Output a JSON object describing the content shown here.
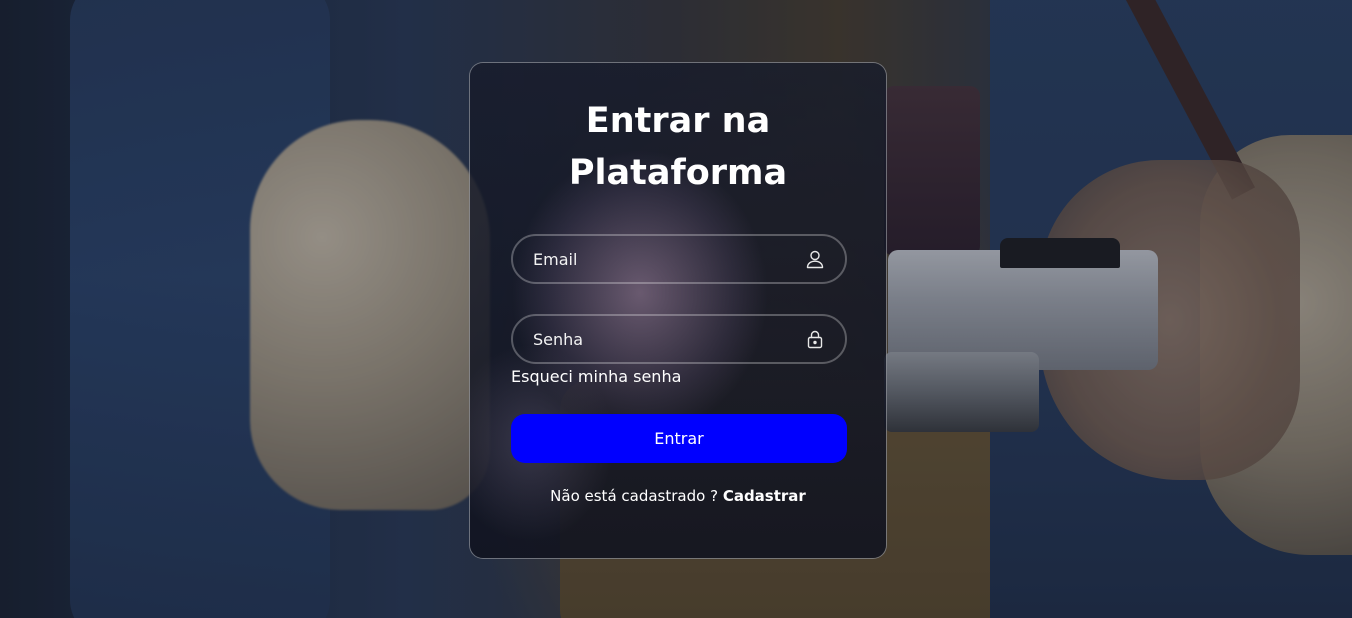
{
  "login": {
    "title_line1": "Entrar na",
    "title_line2": "Plataforma",
    "email": {
      "placeholder": "Email",
      "value": "",
      "icon": "user-icon"
    },
    "password": {
      "placeholder": "Senha",
      "value": "",
      "icon": "lock-icon"
    },
    "forgot_password": "Esqueci minha senha",
    "submit_label": "Entrar",
    "register_prompt": "Não está cadastrado ?",
    "register_link": "Cadastrar"
  },
  "colors": {
    "button": "#0000ff",
    "text": "#ffffff"
  }
}
